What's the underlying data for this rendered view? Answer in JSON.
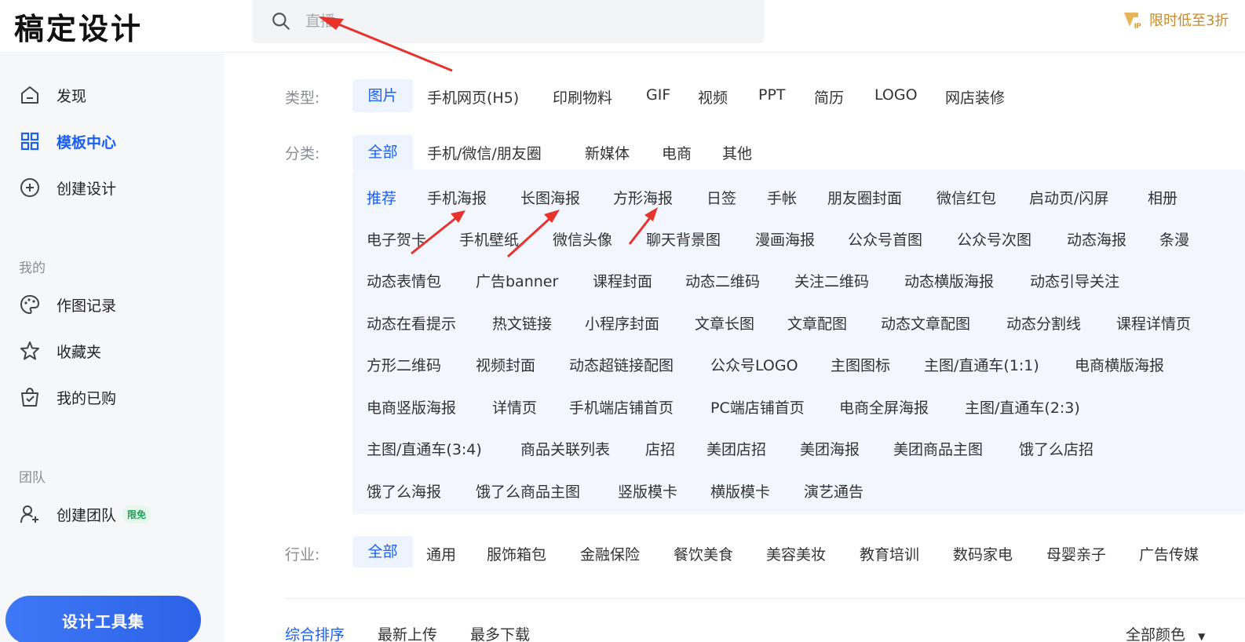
{
  "header": {
    "logo": "稿定设计",
    "search_placeholder": "直播",
    "vip_text": "限时低至3折"
  },
  "sidebar": {
    "items_top": [
      {
        "label": "发现",
        "icon": "home-icon"
      },
      {
        "label": "模板中心",
        "icon": "grid-icon",
        "active": true
      },
      {
        "label": "创建设计",
        "icon": "plus-circle-icon"
      }
    ],
    "section_mine": "我的",
    "items_mine": [
      {
        "label": "作图记录",
        "icon": "palette-icon"
      },
      {
        "label": "收藏夹",
        "icon": "star-icon"
      },
      {
        "label": "我的已购",
        "icon": "shopping-bag-icon"
      }
    ],
    "section_team": "团队",
    "items_team": [
      {
        "label": "创建团队",
        "icon": "team-icon",
        "badge": "限免"
      }
    ],
    "tools_button": "设计工具集"
  },
  "filters": {
    "type_label": "类型:",
    "types": [
      "图片",
      "手机网页(H5)",
      "印刷物料",
      "GIF",
      "视频",
      "PPT",
      "简历",
      "LOGO",
      "网店装修"
    ],
    "category_label": "分类:",
    "categories": [
      "全部",
      "手机/微信/朋友圈",
      "新媒体",
      "电商",
      "其他"
    ],
    "subcategories": [
      [
        "推荐",
        "手机海报",
        "长图海报",
        "方形海报",
        "日签",
        "手帐",
        "朋友圈封面",
        "微信红包",
        "启动页/闪屏",
        "相册"
      ],
      [
        "电子贺卡",
        "手机壁纸",
        "微信头像",
        "聊天背景图",
        "漫画海报",
        "公众号首图",
        "公众号次图",
        "动态海报",
        "条漫"
      ],
      [
        "动态表情包",
        "广告banner",
        "课程封面",
        "动态二维码",
        "关注二维码",
        "动态横版海报",
        "动态引导关注"
      ],
      [
        "动态在看提示",
        "热文链接",
        "小程序封面",
        "文章长图",
        "文章配图",
        "动态文章配图",
        "动态分割线",
        "课程详情页"
      ],
      [
        "方形二维码",
        "视频封面",
        "动态超链接配图",
        "公众号LOGO",
        "主图图标",
        "主图/直通车(1:1)",
        "电商横版海报"
      ],
      [
        "电商竖版海报",
        "详情页",
        "手机端店铺首页",
        "PC端店铺首页",
        "电商全屏海报",
        "主图/直通车(2:3)"
      ],
      [
        "主图/直通车(3:4)",
        "商品关联列表",
        "店招",
        "美团店招",
        "美团海报",
        "美团商品主图",
        "饿了么店招"
      ],
      [
        "饿了么海报",
        "饿了么商品主图",
        "竖版模卡",
        "横版模卡",
        "演艺通告"
      ]
    ],
    "industry_label": "行业:",
    "industries": [
      "全部",
      "通用",
      "服饰箱包",
      "金融保险",
      "餐饮美食",
      "美容美妆",
      "教育培训",
      "数码家电",
      "母婴亲子",
      "广告传媒"
    ]
  },
  "sort": {
    "options": [
      "综合排序",
      "最新上传",
      "最多下载"
    ],
    "color_select": "全部颜色"
  },
  "colors": {
    "accent": "#1a5ff5",
    "annotation_arrow": "#e8332c"
  }
}
